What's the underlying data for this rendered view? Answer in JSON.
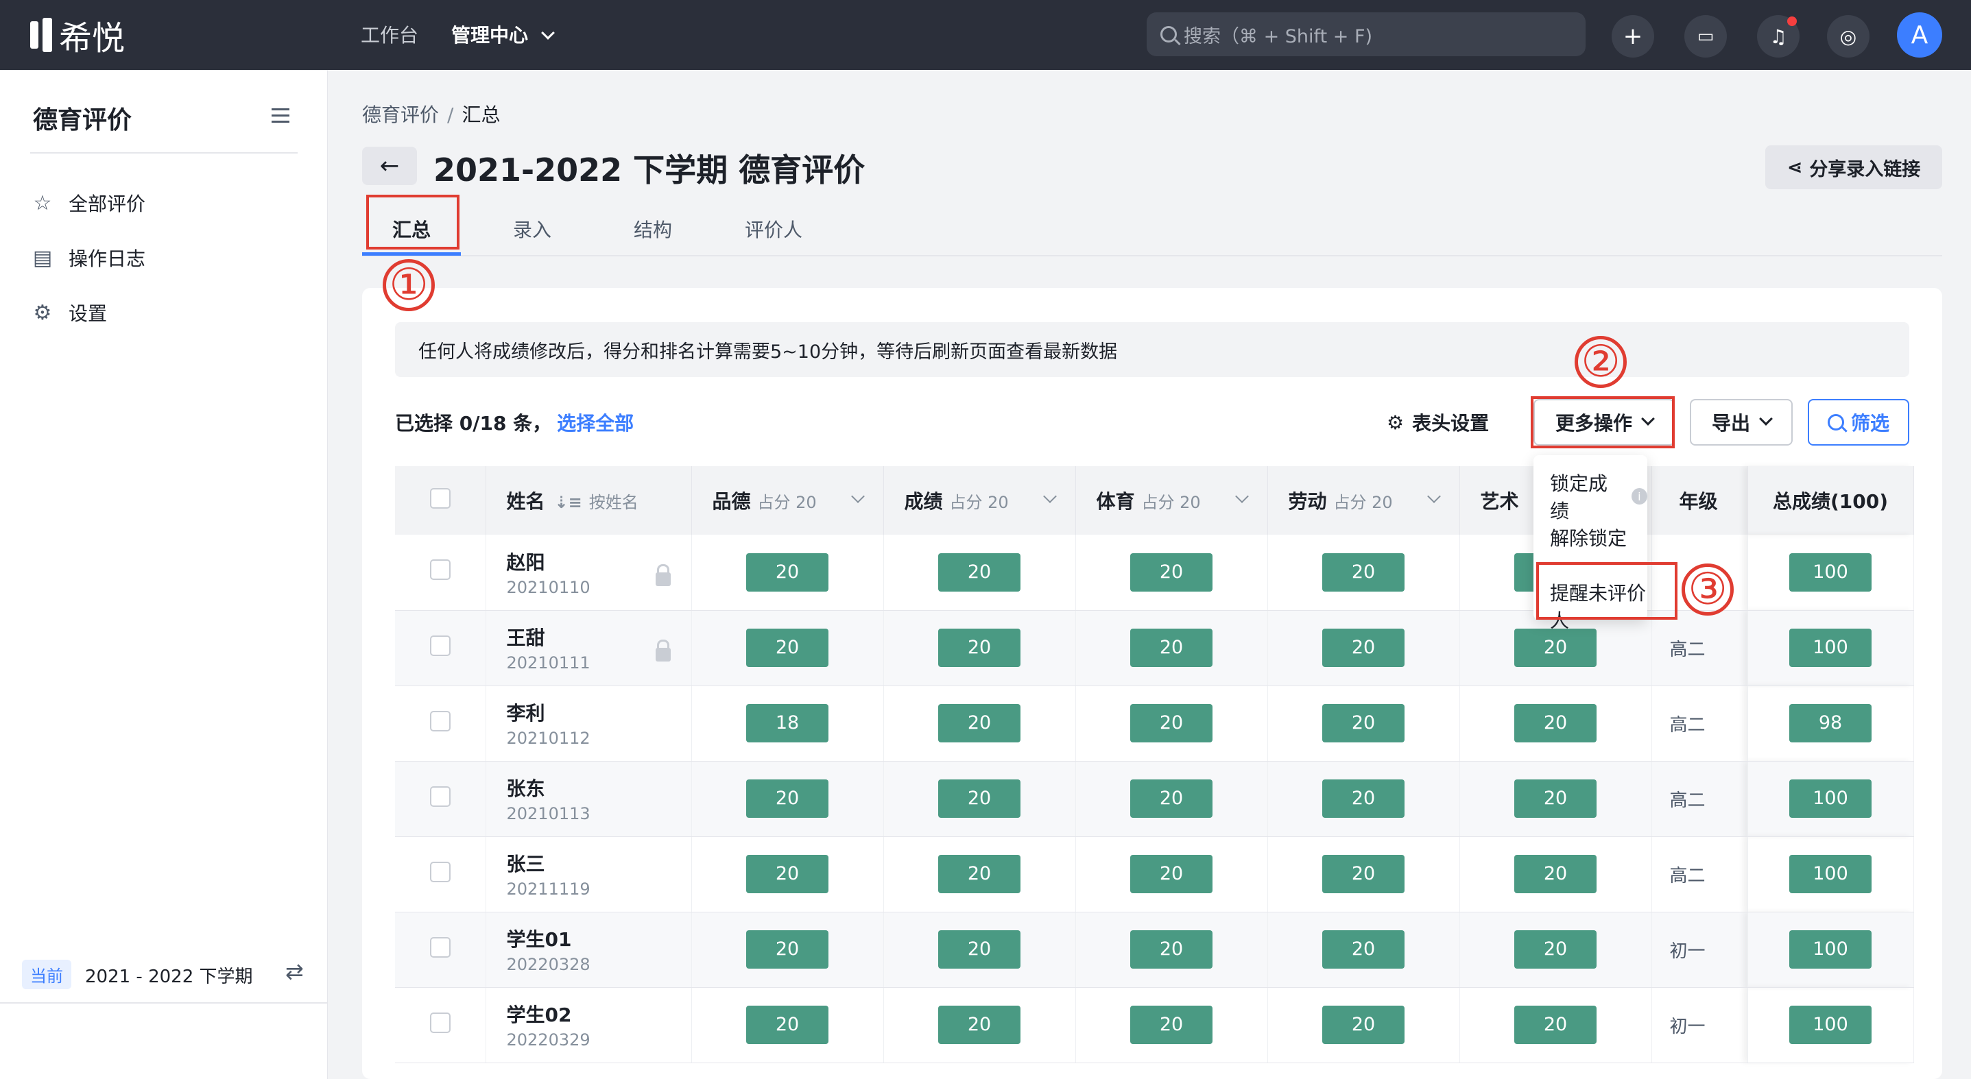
{
  "topbar": {
    "logo_text": "希悦",
    "nav": [
      "工作台",
      "管理中心"
    ],
    "search_placeholder": "搜索（⌘ + Shift + F)",
    "avatar_letter": "A"
  },
  "sidebar": {
    "title": "德育评价",
    "items": [
      {
        "label": "全部评价",
        "icon": "star-icon"
      },
      {
        "label": "操作日志",
        "icon": "log-icon"
      },
      {
        "label": "设置",
        "icon": "gear-icon"
      }
    ],
    "term_badge": "当前",
    "term": "2021 - 2022 下学期"
  },
  "breadcrumb": {
    "parent": "德育评价",
    "separator": "/",
    "current": "汇总"
  },
  "page_title": "2021-2022 下学期 德育评价",
  "share_label": "分享录入链接",
  "tabs": [
    "汇总",
    "录入",
    "结构",
    "评价人"
  ],
  "annotations": [
    "①",
    "②",
    "③"
  ],
  "notice": "任何人将成绩修改后，得分和排名计算需要5~10分钟，等待后刷新页面查看最新数据",
  "selection": {
    "text": "已选择 0/18 条，",
    "select_all": "选择全部"
  },
  "toolbar": {
    "header_settings": "表头设置",
    "more_actions": "更多操作",
    "export": "导出",
    "filter": "筛选"
  },
  "dropdown": [
    "锁定成绩",
    "解除锁定",
    "提醒未评价人"
  ],
  "table": {
    "name_header": "姓名",
    "sort_label": "按姓名",
    "columns": [
      {
        "name": "品德",
        "weight": "占分 20"
      },
      {
        "name": "成绩",
        "weight": "占分 20"
      },
      {
        "name": "体育",
        "weight": "占分 20"
      },
      {
        "name": "劳动",
        "weight": "占分 20"
      },
      {
        "name": "艺术",
        "weight": ""
      }
    ],
    "grade_header": "年级",
    "total_header": "总成绩(100)",
    "rows": [
      {
        "name": "赵阳",
        "id": "20210110",
        "locked": true,
        "scores": [
          "20",
          "20",
          "20",
          "20",
          "20"
        ],
        "grade": "",
        "total": "100"
      },
      {
        "name": "王甜",
        "id": "20210111",
        "locked": true,
        "scores": [
          "20",
          "20",
          "20",
          "20",
          "20"
        ],
        "grade": "高二",
        "total": "100"
      },
      {
        "name": "李利",
        "id": "20210112",
        "locked": false,
        "scores": [
          "18",
          "20",
          "20",
          "20",
          "20"
        ],
        "grade": "高二",
        "total": "98"
      },
      {
        "name": "张东",
        "id": "20210113",
        "locked": false,
        "scores": [
          "20",
          "20",
          "20",
          "20",
          "20"
        ],
        "grade": "高二",
        "total": "100"
      },
      {
        "name": "张三",
        "id": "20211119",
        "locked": false,
        "scores": [
          "20",
          "20",
          "20",
          "20",
          "20"
        ],
        "grade": "高二",
        "total": "100"
      },
      {
        "name": "学生01",
        "id": "20220328",
        "locked": false,
        "scores": [
          "20",
          "20",
          "20",
          "20",
          "20"
        ],
        "grade": "初一",
        "total": "100"
      },
      {
        "name": "学生02",
        "id": "20220329",
        "locked": false,
        "scores": [
          "20",
          "20",
          "20",
          "20",
          "20"
        ],
        "grade": "初一",
        "total": "100"
      }
    ]
  },
  "colors": {
    "accent": "#3c7eff",
    "score_bg": "#4a9a83",
    "annotation": "#e03c31",
    "topbar": "#2b2f3a"
  }
}
